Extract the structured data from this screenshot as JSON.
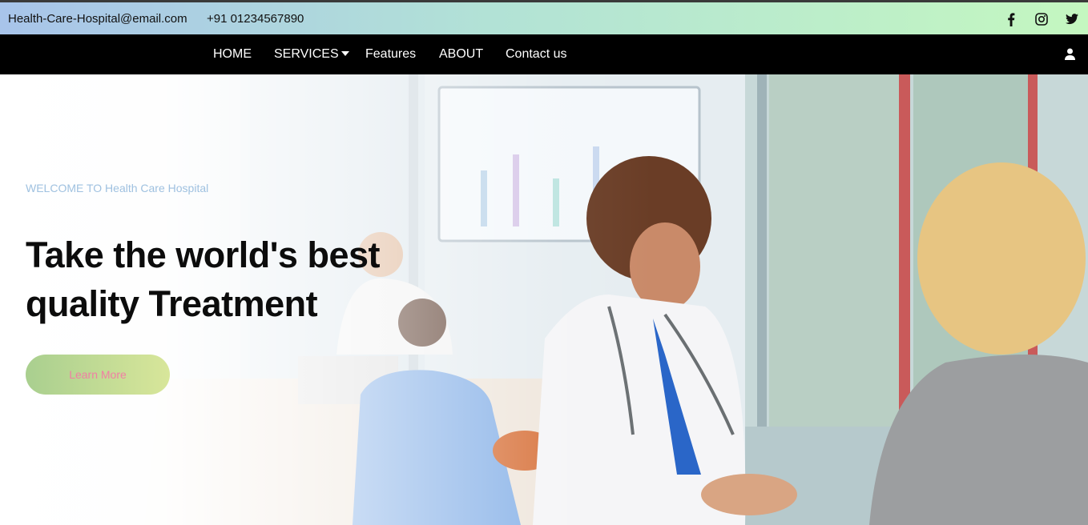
{
  "topbar": {
    "email": "Health-Care-Hospital@email.com",
    "phone": "+91 01234567890",
    "social_icons": [
      "facebook-icon",
      "instagram-icon",
      "twitter-icon"
    ]
  },
  "nav": {
    "items": [
      {
        "label": "HOME"
      },
      {
        "label": "SERVICES"
      },
      {
        "label": "Features"
      },
      {
        "label": "ABOUT"
      },
      {
        "label": "Contact us"
      }
    ],
    "account_icon": "user-icon"
  },
  "hero": {
    "welcome": "WELCOME TO Health Care Hospital",
    "headline_line1": "Take the world's best",
    "headline_line2": "quality Treatment",
    "cta_label": "Learn More"
  },
  "colors": {
    "topbar_gradient_start": "#a8c4ea",
    "topbar_gradient_end": "#c4f7c0",
    "navbar_bg": "#000000",
    "welcome_text": "#9fc1e0",
    "cta_gradient_start": "#a9cf8f",
    "cta_gradient_end": "#d8e69a",
    "cta_text": "#f17fa4"
  }
}
